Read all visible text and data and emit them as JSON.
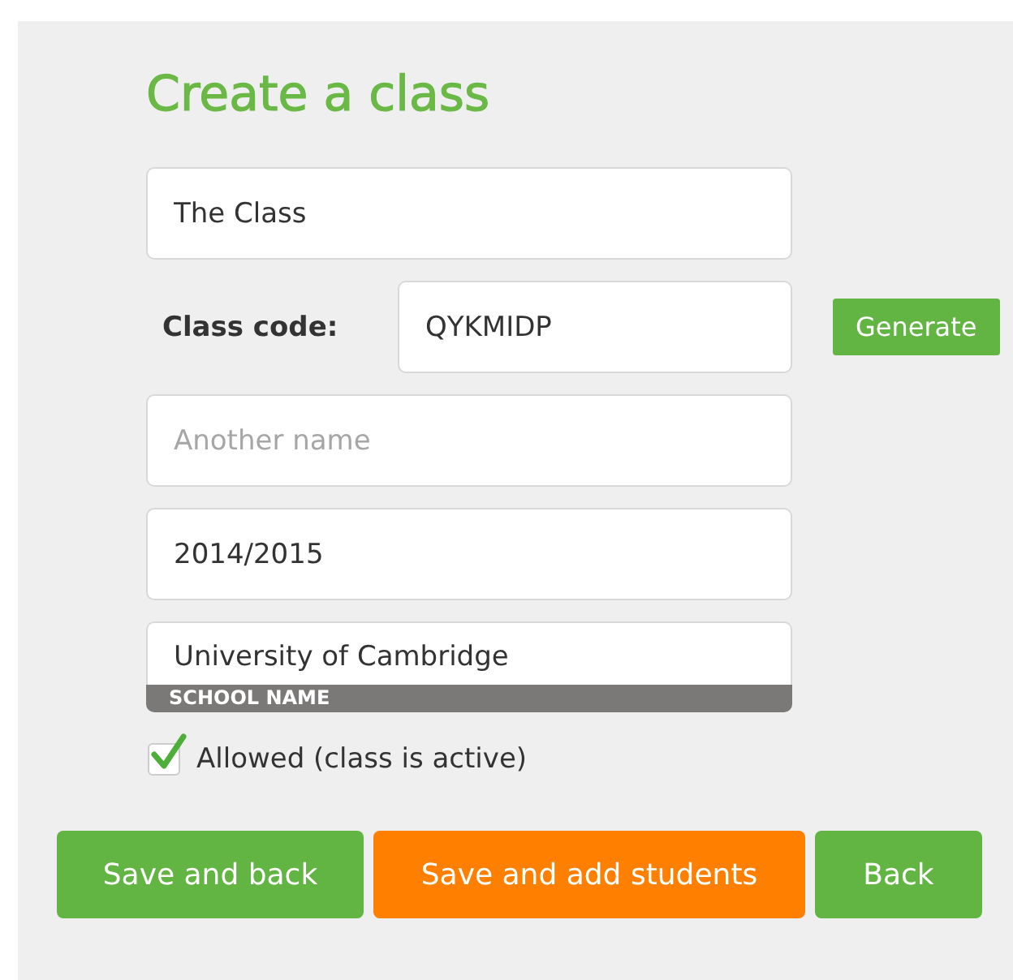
{
  "title": "Create a class",
  "fields": [
    {
      "kind": "text",
      "value": "The Class"
    },
    {
      "kind": "code",
      "label": "Class code:",
      "value": "QYKMIDP",
      "button": "Generate"
    },
    {
      "kind": "text",
      "placeholder": "Another name"
    },
    {
      "kind": "text",
      "value": "2014/2015"
    },
    {
      "kind": "captioned",
      "value": "University of Cambridge",
      "caption": "SCHOOL NAME"
    }
  ],
  "checkbox": {
    "label": "Allowed (class is active)",
    "checked": true
  },
  "buttons": [
    {
      "label": "Save and back",
      "kind": "primary"
    },
    {
      "label": "Save and add students",
      "kind": "accent"
    },
    {
      "label": "Back",
      "kind": "primary"
    }
  ]
}
